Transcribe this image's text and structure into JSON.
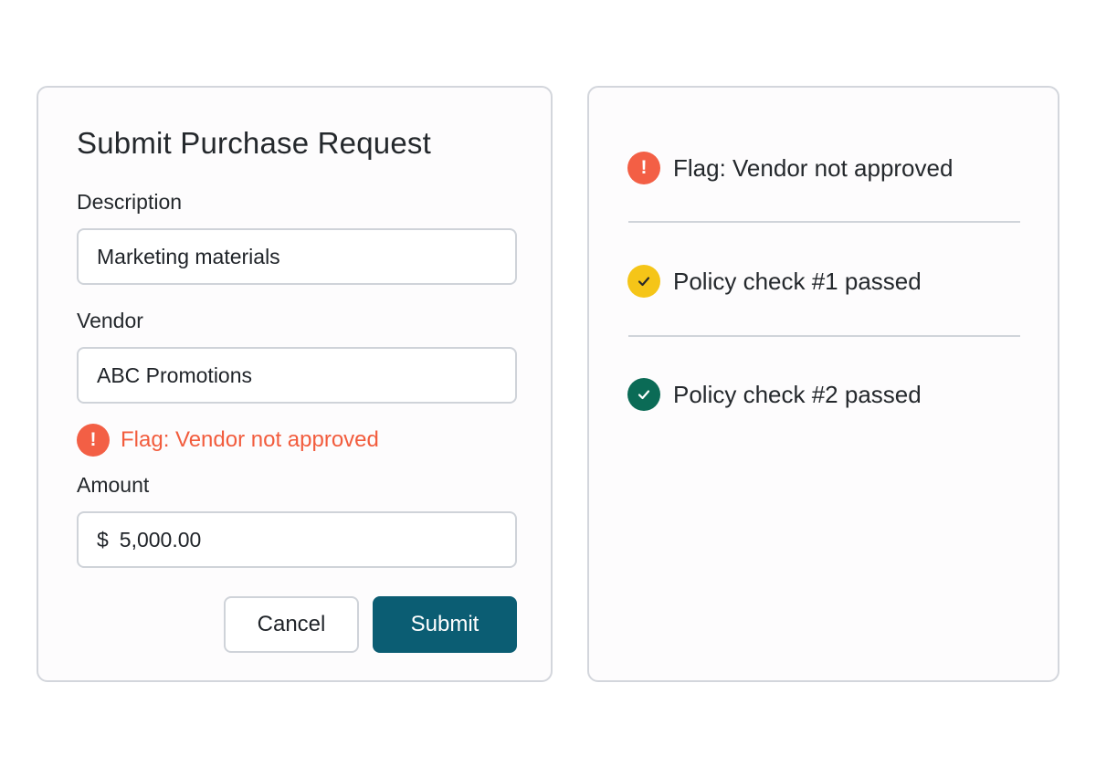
{
  "form": {
    "title": "Submit Purchase Request",
    "description": {
      "label": "Description",
      "value": "Marketing materials"
    },
    "vendor": {
      "label": "Vendor",
      "value": "ABC Promotions",
      "flag": {
        "icon": "exclamation-icon",
        "text": "Flag: Vendor not approved",
        "color": "#f25c3d"
      }
    },
    "amount": {
      "label": "Amount",
      "currency_symbol": "$",
      "value": "5,000.00"
    },
    "buttons": {
      "cancel_label": "Cancel",
      "submit_label": "Submit"
    },
    "submit_color": "#0b5d73"
  },
  "checks": [
    {
      "icon": "exclamation-icon",
      "text": "Flag: Vendor not approved",
      "status": "error",
      "color": "#f35f45"
    },
    {
      "icon": "checkmark-icon",
      "text": "Policy check #1 passed",
      "status": "warning",
      "color": "#f5c518"
    },
    {
      "icon": "checkmark-icon",
      "text": "Policy check #2 passed",
      "status": "passed",
      "color": "#0b6b56"
    }
  ]
}
